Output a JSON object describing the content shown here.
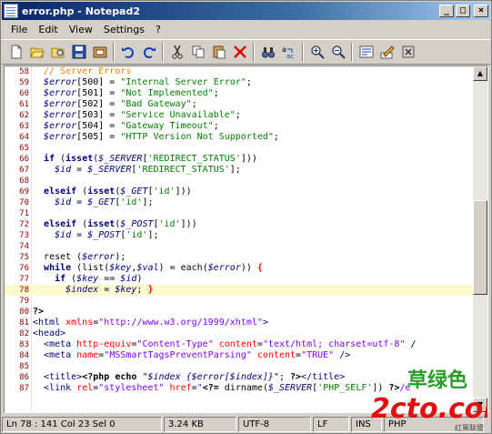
{
  "window": {
    "title": "error.php - Notepad2",
    "minimize": "_",
    "maximize": "□",
    "close": "×"
  },
  "menu": [
    "File",
    "Edit",
    "View",
    "Settings",
    "?"
  ],
  "toolbar": [
    "new-file-icon",
    "open-folder-icon",
    "browse-icon",
    "save-icon",
    "save-copy-icon",
    "undo-icon",
    "redo-icon",
    "cut-icon",
    "copy-icon",
    "paste-icon",
    "delete-icon",
    "find-icon",
    "replace-icon",
    "zoom-in-icon",
    "zoom-out-icon",
    "wordwrap-icon",
    "settings-icon",
    "exit-icon"
  ],
  "colors": {
    "title_from": "#0a246a",
    "title_to": "#a6caf0",
    "current_line": "#fffacd",
    "line_numbers": "#a00000"
  },
  "code_lines": [
    {
      "n": "58",
      "t": [
        [
          "c-cmt",
          "  // Server Errors"
        ]
      ]
    },
    {
      "n": "59",
      "t": [
        [
          "",
          "  "
        ],
        [
          "c-var",
          "$error"
        ],
        [
          "c-op",
          "[500] = "
        ],
        [
          "c-str",
          "\"Internal Server Error\""
        ],
        [
          "c-op",
          ";"
        ]
      ]
    },
    {
      "n": "60",
      "t": [
        [
          "",
          "  "
        ],
        [
          "c-var",
          "$error"
        ],
        [
          "c-op",
          "[501] = "
        ],
        [
          "c-str",
          "\"Not Implemented\""
        ],
        [
          "c-op",
          ";"
        ]
      ]
    },
    {
      "n": "61",
      "t": [
        [
          "",
          "  "
        ],
        [
          "c-var",
          "$error"
        ],
        [
          "c-op",
          "[502] = "
        ],
        [
          "c-str",
          "\"Bad Gateway\""
        ],
        [
          "c-op",
          ";"
        ]
      ]
    },
    {
      "n": "62",
      "t": [
        [
          "",
          "  "
        ],
        [
          "c-var",
          "$error"
        ],
        [
          "c-op",
          "[503] = "
        ],
        [
          "c-str",
          "\"Service Unavailable\""
        ],
        [
          "c-op",
          ";"
        ]
      ]
    },
    {
      "n": "63",
      "t": [
        [
          "",
          "  "
        ],
        [
          "c-var",
          "$error"
        ],
        [
          "c-op",
          "[504] = "
        ],
        [
          "c-str",
          "\"Gateway Timeout\""
        ],
        [
          "c-op",
          ";"
        ]
      ]
    },
    {
      "n": "64",
      "t": [
        [
          "",
          "  "
        ],
        [
          "c-var",
          "$error"
        ],
        [
          "c-op",
          "[505] = "
        ],
        [
          "c-str",
          "\"HTTP Version Not Supported\""
        ],
        [
          "c-op",
          ";"
        ]
      ]
    },
    {
      "n": "65",
      "t": []
    },
    {
      "n": "66",
      "t": [
        [
          "",
          "  "
        ],
        [
          "c-kw",
          "if"
        ],
        [
          "c-op",
          " ("
        ],
        [
          "c-kw",
          "isset"
        ],
        [
          "c-op",
          "("
        ],
        [
          "c-var",
          "$_SERVER"
        ],
        [
          "c-op",
          "["
        ],
        [
          "c-str",
          "'REDIRECT_STATUS'"
        ],
        [
          "c-op",
          "]))"
        ]
      ]
    },
    {
      "n": "67",
      "t": [
        [
          "",
          "    "
        ],
        [
          "c-var",
          "$id"
        ],
        [
          "c-op",
          " = "
        ],
        [
          "c-var",
          "$_SERVER"
        ],
        [
          "c-op",
          "["
        ],
        [
          "c-str",
          "'REDIRECT_STATUS'"
        ],
        [
          "c-op",
          "];"
        ]
      ]
    },
    {
      "n": "68",
      "t": []
    },
    {
      "n": "69",
      "t": [
        [
          "",
          "  "
        ],
        [
          "c-kw",
          "elseif"
        ],
        [
          "c-op",
          " ("
        ],
        [
          "c-kw",
          "isset"
        ],
        [
          "c-op",
          "("
        ],
        [
          "c-var",
          "$_GET"
        ],
        [
          "c-op",
          "["
        ],
        [
          "c-str",
          "'id'"
        ],
        [
          "c-op",
          "]))"
        ]
      ]
    },
    {
      "n": "70",
      "t": [
        [
          "",
          "    "
        ],
        [
          "c-var",
          "$id"
        ],
        [
          "c-op",
          " = "
        ],
        [
          "c-var",
          "$_GET"
        ],
        [
          "c-op",
          "["
        ],
        [
          "c-str",
          "'id'"
        ],
        [
          "c-op",
          "];"
        ]
      ]
    },
    {
      "n": "71",
      "t": []
    },
    {
      "n": "72",
      "t": [
        [
          "",
          "  "
        ],
        [
          "c-kw",
          "elseif"
        ],
        [
          "c-op",
          " ("
        ],
        [
          "c-kw",
          "isset"
        ],
        [
          "c-op",
          "("
        ],
        [
          "c-var",
          "$_POST"
        ],
        [
          "c-op",
          "["
        ],
        [
          "c-str",
          "'id'"
        ],
        [
          "c-op",
          "]))"
        ]
      ]
    },
    {
      "n": "73",
      "t": [
        [
          "",
          "    "
        ],
        [
          "c-var",
          "$id"
        ],
        [
          "c-op",
          " = "
        ],
        [
          "c-var",
          "$_POST"
        ],
        [
          "c-op",
          "["
        ],
        [
          "c-str",
          "'id'"
        ],
        [
          "c-op",
          "];"
        ]
      ]
    },
    {
      "n": "74",
      "t": []
    },
    {
      "n": "75",
      "t": [
        [
          "",
          "  "
        ],
        [
          "c-op",
          "reset ("
        ],
        [
          "c-var",
          "$error"
        ],
        [
          "c-op",
          ");"
        ]
      ]
    },
    {
      "n": "76",
      "t": [
        [
          "",
          "  "
        ],
        [
          "c-kw",
          "while"
        ],
        [
          "c-op",
          " (list("
        ],
        [
          "c-var",
          "$key"
        ],
        [
          "c-op",
          ","
        ],
        [
          "c-var",
          "$val"
        ],
        [
          "c-op",
          ") = each("
        ],
        [
          "c-var",
          "$error"
        ],
        [
          "c-op",
          ")) "
        ],
        [
          "c-brace",
          "{"
        ]
      ]
    },
    {
      "n": "77",
      "t": [
        [
          "",
          "    "
        ],
        [
          "c-kw",
          "if"
        ],
        [
          "c-op",
          " ("
        ],
        [
          "c-var",
          "$key"
        ],
        [
          "c-op",
          " == "
        ],
        [
          "c-var",
          "$id"
        ],
        [
          "c-op",
          ")"
        ]
      ]
    },
    {
      "n": "78",
      "t": [
        [
          "",
          "      "
        ],
        [
          "c-var",
          "$index"
        ],
        [
          "c-op",
          " = "
        ],
        [
          "c-var",
          "$key"
        ],
        [
          "c-op",
          "; "
        ],
        [
          "c-brace",
          "}"
        ]
      ],
      "cur": true
    },
    {
      "n": "79",
      "t": []
    },
    {
      "n": "80",
      "t": [
        [
          "c-php",
          "?>"
        ]
      ]
    },
    {
      "n": "81",
      "t": [
        [
          "c-tag",
          "<html "
        ],
        [
          "c-attr",
          "xmlns"
        ],
        [
          "c-op",
          "="
        ],
        [
          "c-val",
          "\"http://www.w3.org/1999/xhtml\""
        ],
        [
          "c-tag",
          ">"
        ]
      ]
    },
    {
      "n": "82",
      "t": [
        [
          "c-tag",
          "<head>"
        ]
      ]
    },
    {
      "n": "83",
      "t": [
        [
          "",
          "  "
        ],
        [
          "c-tag",
          "<meta "
        ],
        [
          "c-attr",
          "http-equiv"
        ],
        [
          "c-op",
          "="
        ],
        [
          "c-val",
          "\"Content-Type\""
        ],
        [
          "c-op",
          " "
        ],
        [
          "c-attr",
          "content"
        ],
        [
          "c-op",
          "="
        ],
        [
          "c-val",
          "\"text/html; charset=utf-8\""
        ],
        [
          "c-op",
          " /"
        ]
      ]
    },
    {
      "n": "84",
      "t": [
        [
          "",
          "  "
        ],
        [
          "c-tag",
          "<meta "
        ],
        [
          "c-attr",
          "name"
        ],
        [
          "c-op",
          "="
        ],
        [
          "c-val",
          "\"MSSmartTagsPreventParsing\""
        ],
        [
          "c-op",
          " "
        ],
        [
          "c-attr",
          "content"
        ],
        [
          "c-op",
          "="
        ],
        [
          "c-val",
          "\"TRUE\""
        ],
        [
          "c-tag",
          " />"
        ]
      ]
    },
    {
      "n": "85",
      "t": []
    },
    {
      "n": "86",
      "t": [
        [
          "",
          "  "
        ],
        [
          "c-tag",
          "<title>"
        ],
        [
          "c-php",
          "<?php echo "
        ],
        [
          "c-op",
          "\""
        ],
        [
          "c-var",
          "$index {$error[$index]}"
        ],
        [
          "c-op",
          "\"; "
        ],
        [
          "c-php",
          "?>"
        ],
        [
          "c-tag",
          "</title>"
        ]
      ]
    },
    {
      "n": "87",
      "t": [
        [
          "",
          "  "
        ],
        [
          "c-tag",
          "<link "
        ],
        [
          "c-attr",
          "rel"
        ],
        [
          "c-op",
          "="
        ],
        [
          "c-val",
          "\"stylesheet\""
        ],
        [
          "c-op",
          " "
        ],
        [
          "c-attr",
          "href"
        ],
        [
          "c-op",
          "="
        ],
        [
          "c-val",
          "\""
        ],
        [
          "c-php",
          "<?= "
        ],
        [
          "c-op",
          "dirname("
        ],
        [
          "c-var",
          "$_SERVER"
        ],
        [
          "c-op",
          "["
        ],
        [
          "c-str",
          "'PHP_SELF'"
        ],
        [
          "c-op",
          "]) "
        ],
        [
          "c-php",
          "?>"
        ],
        [
          "c-val",
          "/e"
        ]
      ]
    }
  ],
  "status": {
    "position": "Ln 78 : 141  Col 23  Sel 0",
    "size": "3.24 KB",
    "encoding": "UTF-8",
    "eol": "LF",
    "mode": "INS",
    "lexer": "PHP"
  },
  "watermark": {
    "text": "草绿色",
    "logo": "2cto.com",
    "small": "红黑联盟"
  }
}
